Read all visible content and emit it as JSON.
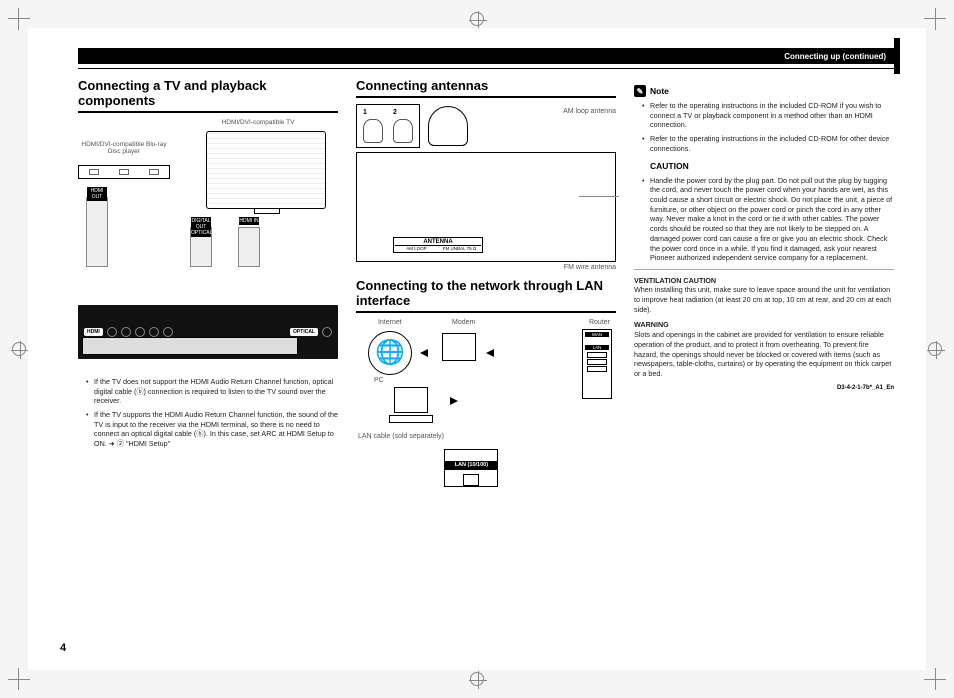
{
  "header": {
    "section_title": "Connecting up (continued)"
  },
  "col1": {
    "heading": "Connecting a TV and playback components",
    "label_bluray": "HDMI/DVI-compatible Blu-ray Disc player",
    "label_tv": "HDMI/DVI-compatible TV",
    "conn_hdmi_out": "HDMI OUT",
    "conn_optical": "DIGITAL OUT OPTICAL",
    "conn_hdmi_in": "HDMI IN",
    "panel_hdmi": "HDMI",
    "panel_optical": "OPTICAL",
    "bullets": [
      "If the TV does not support the HDMI Audio Return Channel function, optical digital cable (ⓑ) connection is required to listen to the TV sound over the receiver.",
      "If the TV supports the HDMI Audio Return Channel function, the sound of the TV is input to the receiver via the HDMI terminal, so there is no need to connect an optical digital cable (ⓑ). In this case, set ARC at HDMI Setup to ON. ➜ ② \"HDMI Setup\""
    ]
  },
  "col2": {
    "heading_ant": "Connecting antennas",
    "ant_step1": "1",
    "ant_step2": "2",
    "ant_loop_label": "AM loop antenna",
    "ant_panel": "ANTENNA",
    "ant_amloop": "AM LOOP",
    "ant_fm": "FM UNBAL 75 Ω",
    "ant_fm_label": "FM wire antenna",
    "heading_lan": "Connecting to the network through LAN interface",
    "net_internet": "Internet",
    "net_modem": "Modem",
    "net_router": "Router",
    "net_pc": "PC",
    "net_wan": "WAN",
    "net_lan": "LAN",
    "net_cable": "LAN cable (sold separately)",
    "net_port_label": "LAN (10/100)"
  },
  "col3": {
    "note_heading": "Note",
    "note_bullets": [
      "Refer to the operating instructions in the included CD-ROM if you wish to connect a TV or playback component in a method other than an HDMI connection.",
      "Refer to the operating instructions in the included CD-ROM for other device connections."
    ],
    "caution_heading": "CAUTION",
    "caution_bullets": [
      "Handle the power cord by the plug part. Do not pull out the plug by tugging the cord, and never touch the power cord when your hands are wet, as this could cause a short circuit or electric shock. Do not place the unit, a piece of furniture, or other object on the power cord or pinch the cord in any other way. Never make a knot in the cord or tie it with other cables. The power cords should be routed so that they are not likely to be stepped on. A damaged power cord can cause a fire or give you an electric shock. Check the power cord once in a while. If you find it damaged, ask your nearest Pioneer authorized independent service company for a replacement."
    ],
    "vent_heading": "VENTILATION CAUTION",
    "vent_text": "When installing this unit, make sure to leave space around the unit for ventilation to improve heat radiation (at least 20 cm at top, 10 cm at rear, and 20 cm at each side).",
    "warn_heading": "WARNING",
    "warn_text": "Slots and openings in the cabinet are provided for ventilation to ensure reliable operation of the product, and to protect it from overheating. To prevent fire hazard, the openings should never be blocked or covered with items (such as newspapers, table-cloths, curtains) or by operating the equipment on thick carpet or a bed.",
    "code": "D3-4-2-1-7b*_A1_En"
  },
  "page_number": "4"
}
